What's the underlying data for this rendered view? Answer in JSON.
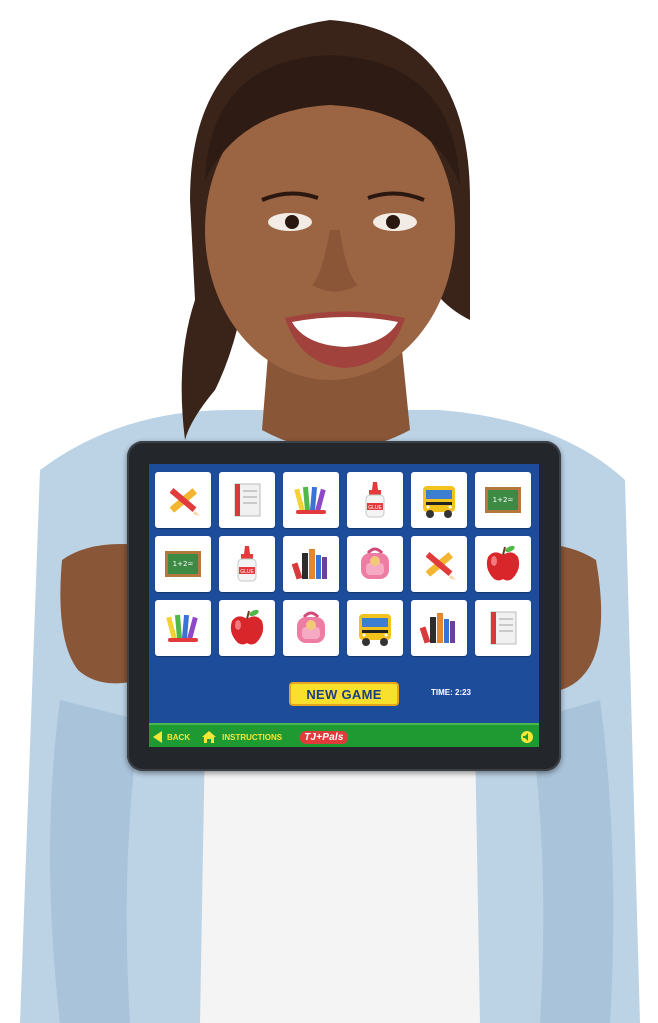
{
  "game": {
    "new_game_label": "NEW GAME",
    "time_label": "TIME: 2:23",
    "cards": [
      {
        "icon": "pencil-ruler-icon"
      },
      {
        "icon": "notebook-icon"
      },
      {
        "icon": "crayons-icon"
      },
      {
        "icon": "glue-bottle-icon"
      },
      {
        "icon": "school-bus-icon"
      },
      {
        "icon": "chalkboard-icon"
      },
      {
        "icon": "chalkboard-icon"
      },
      {
        "icon": "glue-bottle-icon"
      },
      {
        "icon": "books-icon"
      },
      {
        "icon": "backpack-icon"
      },
      {
        "icon": "pencil-ruler-icon"
      },
      {
        "icon": "apple-icon"
      },
      {
        "icon": "crayons-icon"
      },
      {
        "icon": "apple-icon"
      },
      {
        "icon": "backpack-icon"
      },
      {
        "icon": "school-bus-icon"
      },
      {
        "icon": "books-icon"
      },
      {
        "icon": "notebook-icon"
      }
    ],
    "chalkboard_text": "1+2=",
    "glue_label": "GLUE"
  },
  "bottom_bar": {
    "back_label": "BACK",
    "instructions_label": "INSTRUCTIONS",
    "logo_label": "TJ+Pals"
  },
  "colors": {
    "screen_bg": "#1c4c9a",
    "bar_green": "#1f9a33",
    "button_yellow": "#f9e02d",
    "label_yellow": "#f6e736"
  }
}
